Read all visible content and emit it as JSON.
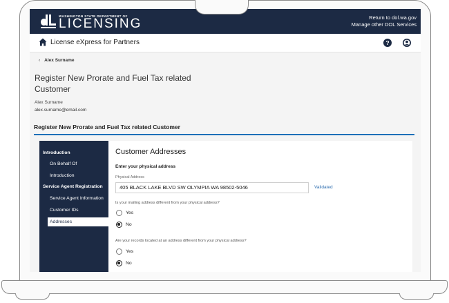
{
  "header": {
    "dept": "WASHINGTON STATE DEPARTMENT OF",
    "name": "LICENSING",
    "links": [
      "Return to dol.wa.gov",
      "Manage other DOL Services"
    ]
  },
  "appbar": {
    "title": "License eXpress for Partners"
  },
  "page": {
    "back_label": "Alex Surname",
    "title": "Register New Prorate and Fuel Tax related Customer",
    "owner_name": "Alex Surname",
    "owner_email": "alex.surname@email.com",
    "section_title": "Register New Prorate and Fuel Tax related Customer"
  },
  "sidenav": {
    "items": [
      {
        "label": "Introduction"
      },
      {
        "label": "On Behalf Of"
      },
      {
        "label": "Introduction"
      },
      {
        "label": "Service Agent Registration"
      },
      {
        "label": "Service Agent Information"
      },
      {
        "label": "Customer IDs"
      },
      {
        "label": "Addresses"
      }
    ]
  },
  "main": {
    "title": "Customer Addresses",
    "subtitle": "Enter your physical address",
    "address_label": "Physical Address",
    "address_value": "405 BLACK LAKE BLVD SW OLYMPIA WA 98502-5046",
    "validated": "Validated",
    "q1": {
      "text": "Is your mailing address different from your physical address?",
      "options": [
        "Yes",
        "No"
      ],
      "selected": "No"
    },
    "q2": {
      "text": "Are your records located at an address different from your physical address?",
      "options": [
        "Yes",
        "No"
      ],
      "selected": "No"
    }
  },
  "colors": {
    "navy": "#1c2a44",
    "accent": "#1c6fb8",
    "link": "#2f6fb0"
  },
  "icons": [
    "home-icon",
    "help-icon",
    "account-icon",
    "chevron-left-icon"
  ]
}
